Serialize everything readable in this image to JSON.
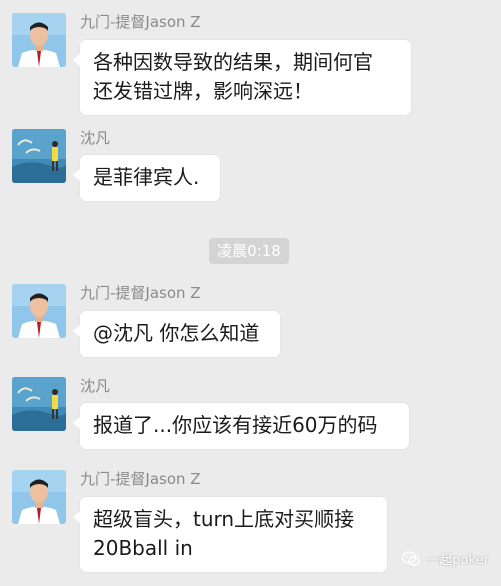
{
  "colors": {
    "background": "#ebebeb",
    "bubble": "#ffffff",
    "sender_text": "#8a8a8a",
    "timestamp_pill": "#d4d4d4"
  },
  "messages": [
    {
      "sender": "九门-提督Jason Z",
      "avatar": "man-portrait-avatar",
      "lines": [
        "各种因数导致的结果，期间何官",
        "还发错过牌，影响深远！"
      ]
    },
    {
      "sender": "沈凡",
      "avatar": "painting-avatar",
      "lines": [
        "是菲律宾人."
      ]
    },
    {
      "sender": "九门-提督Jason Z",
      "avatar": "man-portrait-avatar",
      "lines": [
        "@沈凡 你怎么知道"
      ]
    },
    {
      "sender": "沈凡",
      "avatar": "painting-avatar",
      "lines": [
        "报道了...你应该有接近60万的码"
      ]
    },
    {
      "sender": "九门-提督Jason Z",
      "avatar": "man-portrait-avatar",
      "lines": [
        "超级盲头，turn上底对买顺接",
        "20Bball in"
      ]
    }
  ],
  "timestamp": "凌晨0:18",
  "watermark": {
    "icon": "wechat-icon",
    "text": "一起poker"
  }
}
